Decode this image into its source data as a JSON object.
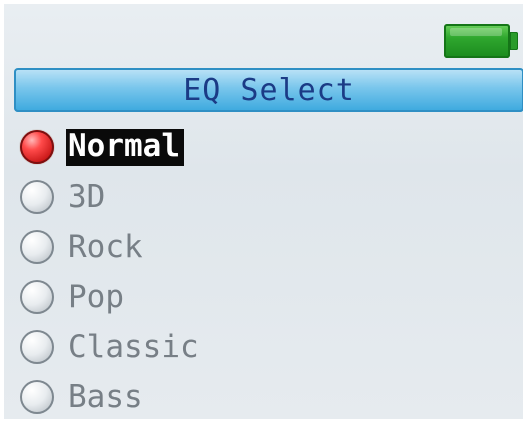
{
  "header": {
    "battery_icon": "battery-full-icon"
  },
  "title": "EQ Select",
  "eq_options": [
    {
      "label": "Normal",
      "selected": true
    },
    {
      "label": "3D",
      "selected": false
    },
    {
      "label": "Rock",
      "selected": false
    },
    {
      "label": "Pop",
      "selected": false
    },
    {
      "label": "Classic",
      "selected": false
    },
    {
      "label": "Bass",
      "selected": false
    }
  ],
  "colors": {
    "title_bar": "#79c6ec",
    "title_text": "#1b3b86",
    "selected_radio": "#e02020",
    "battery": "#2fa72e"
  }
}
